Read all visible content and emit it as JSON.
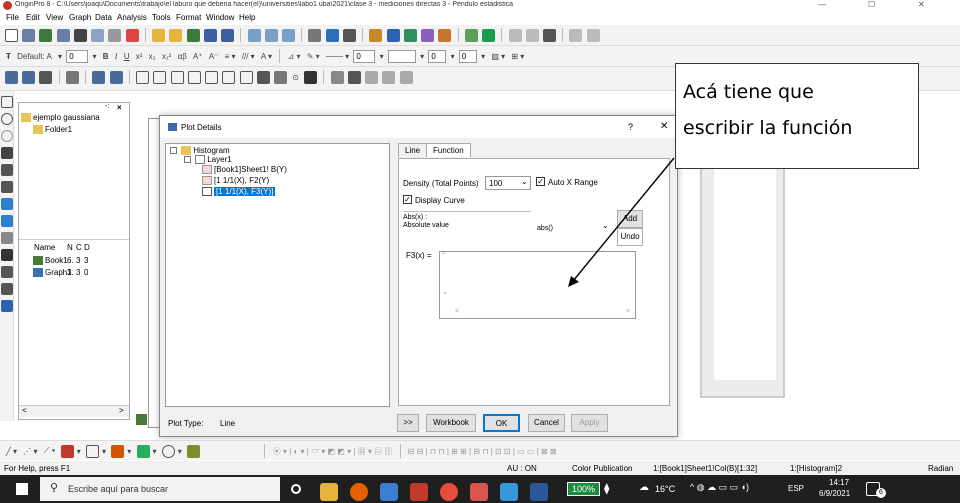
{
  "window": {
    "title": "OriginPro 8 - C:\\Users\\joaqu\\Documents\\trabajo\\el laburo que deberia hacer(el)\\universities\\labo1 uba\\2021\\clase 3 - mediciones directas 3 - Péndulo estadistica",
    "controls": {
      "minimize": "—",
      "maximize": "☐",
      "close": "✕"
    }
  },
  "menu": [
    "File",
    "Edit",
    "View",
    "Graph",
    "Data",
    "Analysis",
    "Tools",
    "Format",
    "Window",
    "Help"
  ],
  "format_bar": {
    "font_label": "Default: A",
    "font_size": "0",
    "bold": "B",
    "italic": "I",
    "underline": "U",
    "line_width": "0",
    "size_a": "0",
    "size_b": "0"
  },
  "project_explorer": {
    "root": "ejemplo gaussiana",
    "folder": "Folder1",
    "columns": [
      "Name",
      "N",
      "C",
      "D"
    ],
    "items": [
      {
        "name": "Book1",
        "cells": [
          "6.",
          "3",
          "3"
        ]
      },
      {
        "name": "Graph1",
        "cells": [
          "3.",
          "3",
          "0"
        ]
      }
    ]
  },
  "dialog": {
    "title": "Plot Details",
    "help": "?",
    "close": "✕",
    "tree": [
      "Histogram",
      "Layer1",
      "[Book1]Sheet1! B(Y)",
      "[1 1/1(X), F2(Y)",
      "[1 1/1(X), F3(Y)]"
    ],
    "tabs": [
      "Line",
      "Function"
    ],
    "density_label": "Density (Total Points)",
    "density_value": "100",
    "auto_x_label": "Auto X Range",
    "display_curve_label": "Display Curve",
    "func_name": "Abs(x) :",
    "func_desc": "Absolute value",
    "func_select": "abs()",
    "add_btn": "Add",
    "undo_btn": "Undo",
    "f3_label": "F3(x) =",
    "plot_type_label": "Plot Type:",
    "plot_type_value": "Line",
    "footer": {
      "more": ">>",
      "workbook": "Workbook",
      "ok": "OK",
      "cancel": "Cancel",
      "apply": "Apply"
    }
  },
  "annotation": {
    "line1": "Acá tiene que",
    "line2": "escribir la función"
  },
  "status": {
    "help": "For Help, press F1",
    "au": "AU : ON",
    "color_pub": "Color Publication",
    "cell_ref": "1:[Book1]Sheet1!Col(B)[1:32]",
    "layer_ref": "1:[Histogram]2",
    "unit": "Radian"
  },
  "taskbar": {
    "search_placeholder": "Escribe aquí para buscar",
    "battery": "100%",
    "weather": "16°C",
    "lang": "ESP",
    "time": "14:17",
    "date": "6/9/2021",
    "notif_count": "6"
  },
  "colors": {
    "accent": "#0078d7",
    "toolbar_bg": "#f3f3f3",
    "dialog_selection": "#0078d7",
    "taskbar_bg": "#1f1f1f"
  }
}
